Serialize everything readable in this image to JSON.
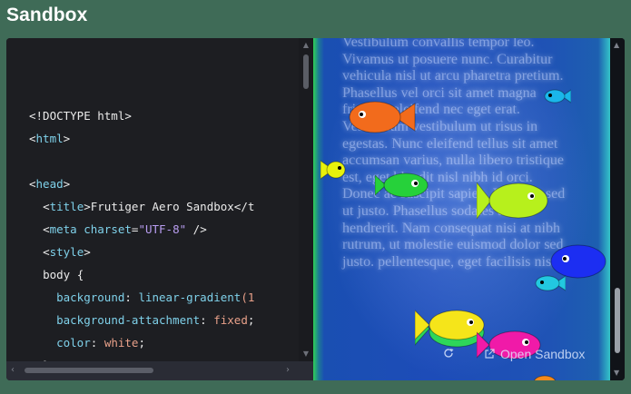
{
  "header": {
    "title": "Sandbox"
  },
  "editor": {
    "lines": [
      {
        "indent": "",
        "parts": []
      },
      {
        "indent": "",
        "parts": [
          {
            "t": "<!DOCTYPE html>",
            "c": "tok-kw"
          }
        ]
      },
      {
        "indent": "",
        "parts": [
          {
            "t": "<",
            "c": "tok-tag"
          },
          {
            "t": "html",
            "c": "tok-attr"
          },
          {
            "t": ">",
            "c": "tok-tag"
          }
        ]
      },
      {
        "indent": "",
        "parts": []
      },
      {
        "indent": "",
        "parts": [
          {
            "t": "<",
            "c": "tok-tag"
          },
          {
            "t": "head",
            "c": "tok-attr"
          },
          {
            "t": ">",
            "c": "tok-tag"
          }
        ]
      },
      {
        "indent": "  ",
        "parts": [
          {
            "t": "<",
            "c": "tok-tag"
          },
          {
            "t": "title",
            "c": "tok-attr"
          },
          {
            "t": ">Frutiger Aero Sandbox</t",
            "c": "tok-tag"
          }
        ]
      },
      {
        "indent": "  ",
        "parts": [
          {
            "t": "<",
            "c": "tok-tag"
          },
          {
            "t": "meta",
            "c": "tok-attr"
          },
          {
            "t": " ",
            "c": "tok-tag"
          },
          {
            "t": "charset",
            "c": "tok-attr"
          },
          {
            "t": "=",
            "c": "tok-tag"
          },
          {
            "t": "\"UTF-8\"",
            "c": "tok-str"
          },
          {
            "t": " />",
            "c": "tok-tag"
          }
        ]
      },
      {
        "indent": "  ",
        "parts": [
          {
            "t": "<",
            "c": "tok-tag"
          },
          {
            "t": "style",
            "c": "tok-attr"
          },
          {
            "t": ">",
            "c": "tok-tag"
          }
        ]
      },
      {
        "indent": "  ",
        "parts": [
          {
            "t": "body",
            "c": "tok-kw"
          },
          {
            "t": " {",
            "c": "tok-tag"
          }
        ]
      },
      {
        "indent": "    ",
        "parts": [
          {
            "t": "background",
            "c": "tok-prop"
          },
          {
            "t": ": ",
            "c": "tok-tag"
          },
          {
            "t": "linear-gradient",
            "c": "tok-prop"
          },
          {
            "t": "(1",
            "c": "tok-val"
          }
        ]
      },
      {
        "indent": "    ",
        "parts": [
          {
            "t": "background-attachment",
            "c": "tok-prop"
          },
          {
            "t": ": ",
            "c": "tok-tag"
          },
          {
            "t": "fixed",
            "c": "tok-val"
          },
          {
            "t": ";",
            "c": "tok-tag"
          }
        ]
      },
      {
        "indent": "    ",
        "parts": [
          {
            "t": "color",
            "c": "tok-prop"
          },
          {
            "t": ": ",
            "c": "tok-tag"
          },
          {
            "t": "white",
            "c": "tok-val"
          },
          {
            "t": ";",
            "c": "tok-tag"
          }
        ]
      },
      {
        "indent": "  ",
        "parts": [
          {
            "t": "}",
            "c": "tok-tag"
          }
        ]
      }
    ]
  },
  "preview": {
    "text": "Vestibulum convallis tempor leo. Vivamus ut posuere nunc. Curabitur vehicula nisl ut arcu pharetra pretium. Phasellus vel orci sit amet magna fringilla eleifend nec eget erat. Vestibulum vestibulum ut risus in egestas. Nunc eleifend tellus sit amet accumsan varius, nulla libero tristique est, eget blandit nisl nibh id orci. Donec ac suscipit sapien. Praesent sed ut justo. Phasellus sodales auctor hendrerit. Nam consequat nisi at nibh rutrum, ut molestie euismod dolor sed justo. pellentesque, eget facilisis nisi",
    "open_label": "Open Sandbox",
    "fish_colors": [
      "#f26b1c",
      "#1ab6ea",
      "#e8f20c",
      "#26d13a",
      "#b7f01c",
      "#1c2ef2",
      "#22c8e0",
      "#f5e51a",
      "#2ed65a",
      "#f01aa8",
      "#f58a1a"
    ]
  }
}
